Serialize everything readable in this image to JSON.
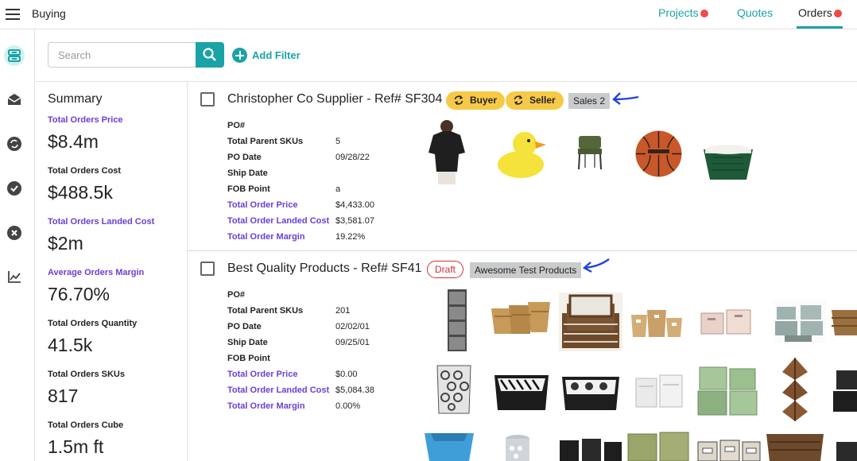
{
  "app": {
    "title": "Buying"
  },
  "nav": {
    "projects": "Projects",
    "quotes": "Quotes",
    "orders": "Orders",
    "accent_color": "#1aa3a6",
    "alert_color": "#ee4b4b"
  },
  "rail": [
    {
      "icon": "orders-tray-icon",
      "active": true
    },
    {
      "icon": "mail-open-icon",
      "active": false
    },
    {
      "icon": "sync-icon",
      "active": false
    },
    {
      "icon": "check-circle-icon",
      "active": false
    },
    {
      "icon": "cancel-circle-icon",
      "active": false
    },
    {
      "icon": "chart-line-icon",
      "active": false
    }
  ],
  "search": {
    "placeholder": "Search",
    "value": ""
  },
  "filter": {
    "add_label": "Add Filter"
  },
  "summary": {
    "title": "Summary",
    "stats": [
      {
        "label": "Total Orders Price",
        "value": "$8.4m",
        "highlight": true
      },
      {
        "label": "Total Orders Cost",
        "value": "$488.5k",
        "highlight": false
      },
      {
        "label": "Total Orders Landed Cost",
        "value": "$2m",
        "highlight": true
      },
      {
        "label": "Average Orders Margin",
        "value": "76.70%",
        "highlight": true
      },
      {
        "label": "Total Orders Quantity",
        "value": "41.5k",
        "highlight": false
      },
      {
        "label": "Total Orders SKUs",
        "value": "817",
        "highlight": false
      },
      {
        "label": "Total Orders Cube",
        "value": "1.5m ft",
        "highlight": false
      }
    ]
  },
  "orders": [
    {
      "title": "Christopher Co Supplier - Ref# SF304",
      "buyer_chip": "Buyer",
      "seller_chip": "Seller",
      "tag": "Sales 2",
      "fields": [
        {
          "label": "PO#",
          "value": ""
        },
        {
          "label": "Total Parent SKUs",
          "value": "5"
        },
        {
          "label": "PO Date",
          "value": "09/28/22"
        },
        {
          "label": "Ship Date",
          "value": ""
        },
        {
          "label": "FOB Point",
          "value": "a"
        },
        {
          "label": "Total Order Price",
          "value": "$4,433.00"
        },
        {
          "label": "Total Order Landed Cost",
          "value": "$3,581.07"
        },
        {
          "label": "Total Order Margin",
          "value": "19.22%"
        }
      ],
      "products": [
        "black-blouse",
        "rubber-duck",
        "green-chair",
        "basketball",
        "green-laundry-basket"
      ]
    },
    {
      "title": "Best Quality Products - Ref# SF41",
      "status": "Draft",
      "tag": "Awesome Test Products",
      "fields": [
        {
          "label": "PO#",
          "value": ""
        },
        {
          "label": "Total Parent SKUs",
          "value": "201"
        },
        {
          "label": "PO Date",
          "value": "02/02/01"
        },
        {
          "label": "Ship Date",
          "value": "09/25/01"
        },
        {
          "label": "FOB Point",
          "value": ""
        },
        {
          "label": "Total Order Price",
          "value": "$0.00"
        },
        {
          "label": "Total Order Landed Cost",
          "value": "$5,084.38"
        },
        {
          "label": "Total Order Margin",
          "value": "0.00%"
        }
      ],
      "products": [
        "drawer-tower",
        "wicker-basket-set",
        "lined-basket-set",
        "rope-basket-set",
        "pink-bin-set",
        "gray-bin-stack",
        "brown-basket",
        "patterned-hamper",
        "zebra-tray",
        "damask-basket",
        "white-cube-bins",
        "green-box-set",
        "woven-hanging-organizer",
        "black-bins",
        "blue-bin",
        "gray-hamper",
        "black-bins-row",
        "green-storage-boxes",
        "labeled-bins",
        "seagrass-basket",
        "black-bin-partial"
      ]
    }
  ]
}
